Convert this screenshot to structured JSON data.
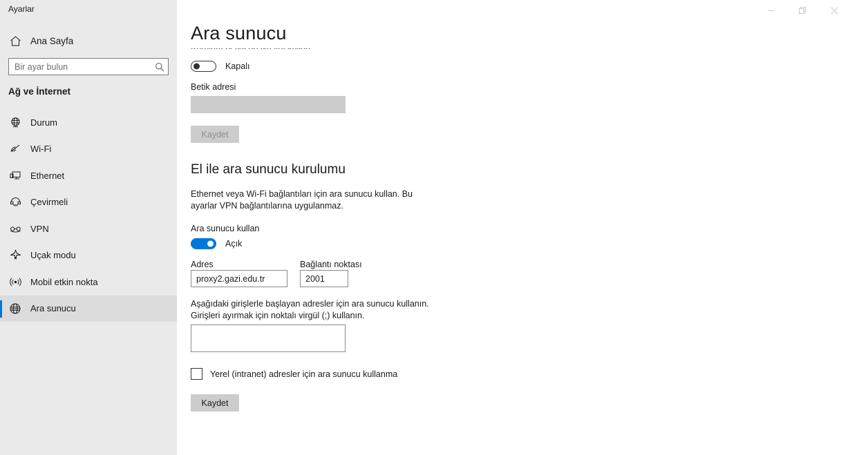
{
  "window": {
    "app_title": "Ayarlar",
    "controls": [
      {
        "name": "minimize-button",
        "label": "—"
      },
      {
        "name": "maximize-restore-button",
        "label": "❐"
      },
      {
        "name": "close-button",
        "label": "✕"
      }
    ]
  },
  "sidebar": {
    "home_label": "Ana Sayfa",
    "search": {
      "placeholder": "Bir ayar bulun",
      "value": ""
    },
    "category": "Ağ ve İnternet",
    "items": [
      {
        "label": "Durum",
        "icon": "globe-status-icon",
        "selected": false
      },
      {
        "label": "Wi-Fi",
        "icon": "wifi-icon",
        "selected": false
      },
      {
        "label": "Ethernet",
        "icon": "ethernet-icon",
        "selected": false
      },
      {
        "label": "Çevirmeli",
        "icon": "dialup-phone-icon",
        "selected": false
      },
      {
        "label": "VPN",
        "icon": "vpn-icon",
        "selected": false
      },
      {
        "label": "Uçak modu",
        "icon": "airplane-icon",
        "selected": false
      },
      {
        "label": "Mobil etkin nokta",
        "icon": "hotspot-icon",
        "selected": false
      },
      {
        "label": "Ara sunucu",
        "icon": "globe-proxy-icon",
        "selected": true
      }
    ]
  },
  "main": {
    "page_title": "Ara sunucu",
    "clipped_heading": "Kurulum betiği dosyasını kullan",
    "script_toggle": {
      "state_label": "Kapalı",
      "on": false
    },
    "script_address": {
      "label": "Betik adresi",
      "value": ""
    },
    "script_save_label": "Kaydet",
    "manual": {
      "title": "El ile ara sunucu kurulumu",
      "description": "Ethernet veya Wi-Fi bağlantıları için ara sunucu kullan. Bu ayarlar VPN bağlantılarına uygulanmaz.",
      "use_proxy_label": "Ara sunucu kullan",
      "proxy_toggle": {
        "state_label": "Açık",
        "on": true
      },
      "address": {
        "label": "Adres",
        "value": "proxy2.gazi.edu.tr"
      },
      "port": {
        "label": "Bağlantı noktası",
        "value": "2001"
      },
      "exceptions_description": "Aşağıdaki girişlerle başlayan adresler için ara sunucu kullanın. Girişleri ayırmak için noktalı virgül (;) kullanın.",
      "exceptions_value": "",
      "bypass_local_label": "Yerel (intranet) adresler için ara sunucu kullanma",
      "bypass_local_checked": false,
      "save_label": "Kaydet"
    }
  },
  "colors": {
    "accent": "#0078d7",
    "sidebar_bg": "#eaeaea",
    "selected_bg": "#dcdcdc",
    "disabled_fill": "#cccccc",
    "tab_remnant": "#6b9aa8"
  }
}
